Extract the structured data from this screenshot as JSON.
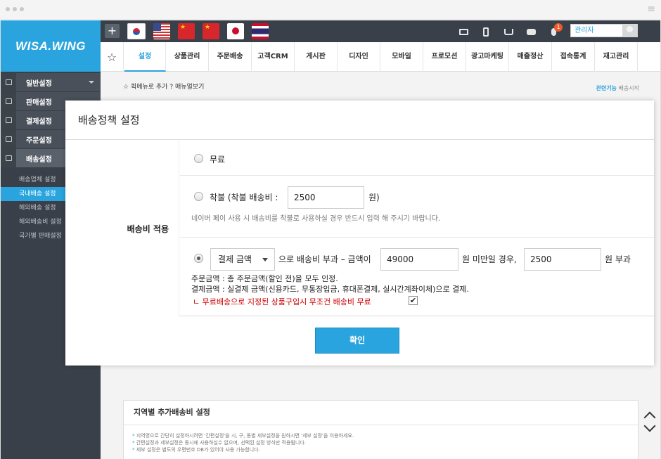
{
  "sidebar": {
    "logo": "WISA.WING",
    "menu": [
      {
        "label": "일반설정"
      },
      {
        "label": "판매설정"
      },
      {
        "label": "결제설정"
      },
      {
        "label": "주문설정"
      },
      {
        "label": "배송설정"
      }
    ],
    "submenu": [
      {
        "label": "배송업체 설정"
      },
      {
        "label": "국내배송 설정"
      },
      {
        "label": "해외배송 설정"
      },
      {
        "label": "해외배송비 설정"
      },
      {
        "label": "국가별 판매설정"
      }
    ]
  },
  "topbar": {
    "add": "+",
    "notification_count": "1",
    "admin_select": "관리자"
  },
  "nav": {
    "tabs": [
      {
        "label": "설정"
      },
      {
        "label": "상품관리"
      },
      {
        "label": "주문배송"
      },
      {
        "label": "고객CRM"
      },
      {
        "label": "게시판"
      },
      {
        "label": "디자인"
      },
      {
        "label": "모바일"
      },
      {
        "label": "프로모션"
      },
      {
        "label": "광고마케팅"
      },
      {
        "label": "매출정산"
      },
      {
        "label": "접속통계"
      },
      {
        "label": "재고관리"
      }
    ]
  },
  "content": {
    "quickbar": "☆ 퀵메뉴로 추가 ? 매뉴얼보기",
    "related_label": "관련기능",
    "related_link": "배송시작"
  },
  "region_panel": {
    "title": "지역별 추가배송비 설정",
    "notes": [
      "지역명으로 간단히 설정하시려면 '간편설정'을 시, 구, 동별 세부설정을 원하시면 '세부 설정'을 이용하세요.",
      "간편설정과 세부설정은 동시에 사용하실수 없으며, 선택된 설정 방식만 적용됩니다.",
      "세부 설정은 별도의 우편번호 DB가 있어야 사용 가능합니다."
    ]
  },
  "modal": {
    "title": "배송정책 설정",
    "row_label": "배송비 적용",
    "option_free": "무료",
    "option_cod_label": "착불 (착불 배송비 :",
    "option_cod_fee": "2500",
    "option_cod_unit": "원)",
    "option_cod_note": "네이버 페이 사용 시 배송비를 착불로 사용하실 경우 반드시 입력 해 주시기 바랍니다.",
    "option_conditional": {
      "select_value": "결제 금액",
      "text1": "으로 배송비 부과 – 금액이",
      "threshold": "49000",
      "text2": "원 미만일 경우,",
      "fee": "2500",
      "text3": "원 부과"
    },
    "rule1": "주문금액 : 총 주문금액(할인 전)을 모두 인정.",
    "rule2": "결제금액 : 실결제 금액(신용카드, 무통장입금, 휴대폰결제, 실시간계좌이체)으로 결제.",
    "free_product_note": "ㄴ 무료배송으로 지정된 상품구입시 무조건 배송비 무료",
    "confirm": "확인"
  }
}
